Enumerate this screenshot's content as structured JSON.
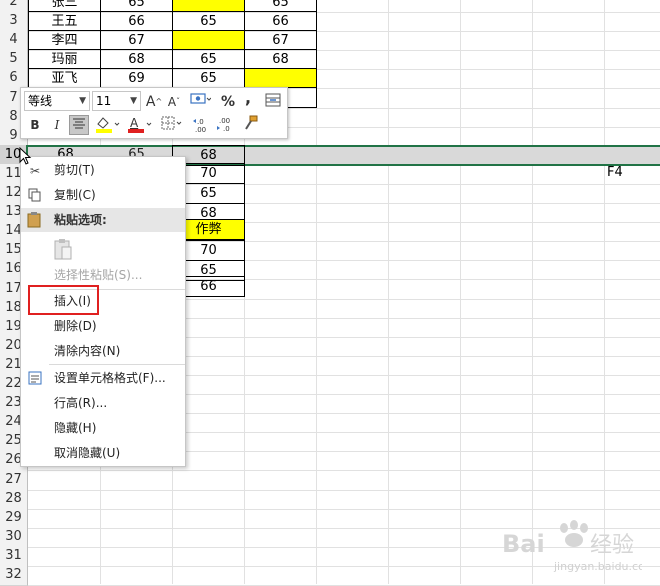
{
  "sheet": {
    "row_numbers": [
      "2",
      "3",
      "4",
      "5",
      "6",
      "7",
      "8",
      "9",
      "10",
      "11",
      "12",
      "13",
      "14",
      "15",
      "16",
      "17",
      "18",
      "19",
      "20",
      "21",
      "22",
      "23",
      "24",
      "25",
      "26",
      "27",
      "28",
      "29",
      "30",
      "31",
      "32"
    ],
    "rows_top": [
      {
        "row": "2",
        "name": "张三",
        "a": "65",
        "b": "",
        "c": "65"
      },
      {
        "row": "3",
        "name": "王五",
        "a": "66",
        "b": "65",
        "c": "66"
      },
      {
        "row": "4",
        "name": "李四",
        "a": "67",
        "b": "",
        "c": "67"
      },
      {
        "row": "5",
        "name": "玛丽",
        "a": "68",
        "b": "65",
        "c": "68"
      },
      {
        "row": "6",
        "name": "亚飞",
        "a": "69",
        "b": "65",
        "c": ""
      }
    ],
    "row10": {
      "name": "68",
      "a": "65",
      "b": "68"
    },
    "col_d_values": {
      "r11": "70",
      "r12": "65",
      "r13": "68",
      "r14": "作弊",
      "r15": "70",
      "r16": "65",
      "r17": "66"
    },
    "f4_text": "F4"
  },
  "minibar": {
    "font_name": "等线",
    "font_size": "11",
    "grow_font": "A",
    "shrink_font": "A",
    "percent": "%",
    "comma": ",",
    "bold": "B",
    "italic": "I",
    "font_color_letter": "A",
    "inc_decimal": "←.0\n.00",
    "dec_decimal": ".00\n→.0"
  },
  "context_menu": {
    "cut": "剪切(T)",
    "copy": "复制(C)",
    "paste_options": "粘贴选项:",
    "paste_special": "选择性粘贴(S)...",
    "insert": "插入(I)",
    "delete": "删除(D)",
    "clear_contents": "清除内容(N)",
    "format_cells": "设置单元格格式(F)...",
    "row_height": "行高(R)...",
    "hide": "隐藏(H)",
    "unhide": "取消隐藏(U)"
  },
  "colors": {
    "highlight": "#ffff00",
    "selection_border": "#217346",
    "callout_red": "#e02020",
    "font_color_bar": "#e02020",
    "fill_color_bar": "#ffff00"
  }
}
